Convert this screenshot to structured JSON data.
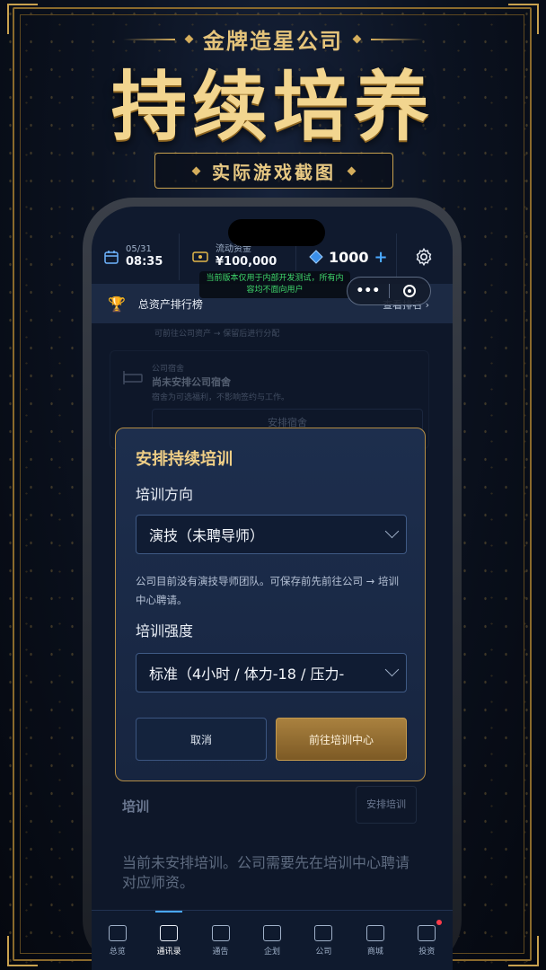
{
  "banner": {
    "company": "金牌造星公司",
    "headline": "持续培养",
    "subtitle": "实际游戏截图"
  },
  "topbar": {
    "date": "05/31",
    "time": "08:35",
    "cash_label": "流动资金",
    "cash_value": "¥100,000",
    "gems": "1000",
    "gems_plus": "+",
    "dev_notice": "当前版本仅用于内部开发测试，所有内容均不面向用户"
  },
  "rank": {
    "label": "总资产排行榜",
    "link": "查看排名 ›"
  },
  "background": {
    "hint1": "可前往公司资产 → 保留后进行分配",
    "dorm_caption": "公司宿舍",
    "dorm_title": "尚未安排公司宿舍",
    "dorm_desc": "宿舍为可选福利，不影响签约与工作。",
    "dorm_btn": "安排宿舍",
    "training_title": "培训",
    "training_btn": "安排培训",
    "training_desc": "当前未安排培训。公司需要先在培训中心聘请对应师资。"
  },
  "modal": {
    "title": "安排持续培训",
    "direction_label": "培训方向",
    "direction_value": "演技（未聘导师）",
    "help": "公司目前没有演技导师团队。可保存前先前往公司 → 培训中心聘请。",
    "intensity_label": "培训强度",
    "intensity_value": "标准（4小时 / 体力-18 / 压力-",
    "cancel": "取消",
    "confirm": "前往培训中心"
  },
  "tabs": [
    {
      "label": "总览",
      "icon": "overview-icon"
    },
    {
      "label": "通讯录",
      "icon": "contacts-icon"
    },
    {
      "label": "通告",
      "icon": "clapper-icon"
    },
    {
      "label": "企划",
      "icon": "clipboard-icon"
    },
    {
      "label": "公司",
      "icon": "building-icon"
    },
    {
      "label": "商城",
      "icon": "shop-icon"
    },
    {
      "label": "投资",
      "icon": "chart-icon"
    }
  ],
  "colors": {
    "gold": "#e5c47b",
    "accent": "#4aa8ff",
    "notice_green": "#3fd66b"
  }
}
